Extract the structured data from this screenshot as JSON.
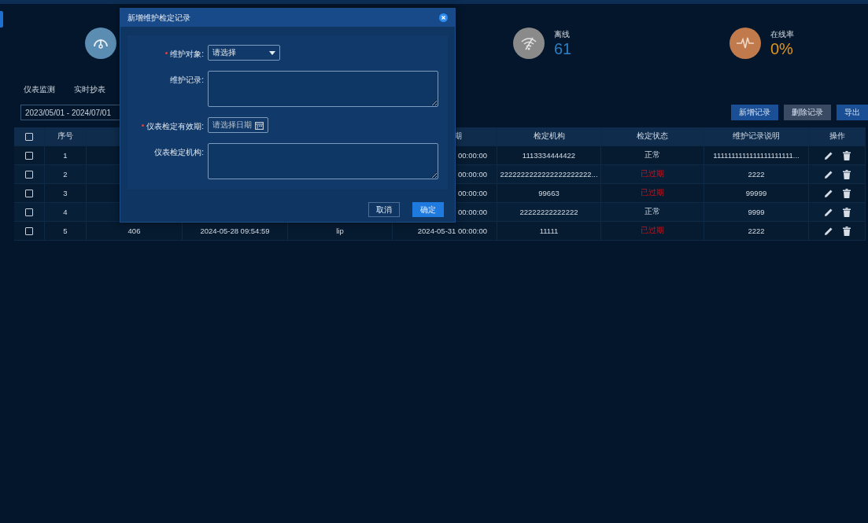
{
  "stats": [
    {
      "kind": "gauge",
      "color": "#5b8db3"
    },
    {
      "kind": "offline",
      "color": "#8a8a8a",
      "label": "离线",
      "value": "61"
    },
    {
      "kind": "rate",
      "color": "#c07a4c",
      "label": "在线率",
      "value": "0%"
    }
  ],
  "tabs": [
    {
      "label": "仪表监测",
      "selected": false
    },
    {
      "label": "实时抄表",
      "selected": false
    }
  ],
  "date_range": {
    "value": "2023/05/01 - 2024/07/01"
  },
  "buttons": [
    {
      "label": "新增记录",
      "kind": "primary"
    },
    {
      "label": "删除记录",
      "kind": "muted"
    },
    {
      "label": "导出",
      "kind": "primary"
    }
  ],
  "table": {
    "header": {
      "checked": false,
      "index": "序号",
      "column_6": "期",
      "org": "检定机构",
      "status": "检定状态",
      "note": "维护记录说明",
      "actions": "操作"
    },
    "rows": [
      {
        "checked": false,
        "index": "1",
        "column_6": "00:00:00",
        "org": "1113334444422",
        "status": "正常",
        "expired": false,
        "note": "1111111111111111111111..."
      },
      {
        "checked": false,
        "index": "2",
        "column_6": "00:00:00",
        "org": "2222222222222222222222...",
        "status": "已过期",
        "expired": true,
        "note": "2222"
      },
      {
        "checked": false,
        "index": "3",
        "column_6": "00:00:00",
        "org": "99663",
        "status": "已过期",
        "expired": true,
        "note": "99999"
      },
      {
        "checked": false,
        "index": "4",
        "column_6": "00:00:00",
        "org": "22222222222222",
        "status": "正常",
        "expired": false,
        "note": "9999"
      },
      {
        "checked": false,
        "index": "5",
        "column_3": "406",
        "column_4": "2024-05-28 09:54:59",
        "column_5": "lip",
        "column_6": "2024-05-31 00:00:00",
        "org": "11111",
        "status": "已过期",
        "expired": true,
        "note": "2222"
      }
    ]
  },
  "dialog": {
    "title": "新增维护检定记录",
    "fields": [
      {
        "kind": "select",
        "label": "维护对象:",
        "required": true,
        "placeholder": "请选择"
      },
      {
        "kind": "textarea",
        "label": "维护记录:",
        "required": false
      },
      {
        "kind": "date",
        "label": "仪表检定有效期:",
        "required": true,
        "placeholder": "请选择日期"
      },
      {
        "kind": "textarea",
        "label": "仪表检定机构:",
        "required": false
      }
    ],
    "buttons": [
      {
        "label": "取消",
        "kind": "cancel"
      },
      {
        "label": "确定",
        "kind": "confirm"
      }
    ]
  }
}
